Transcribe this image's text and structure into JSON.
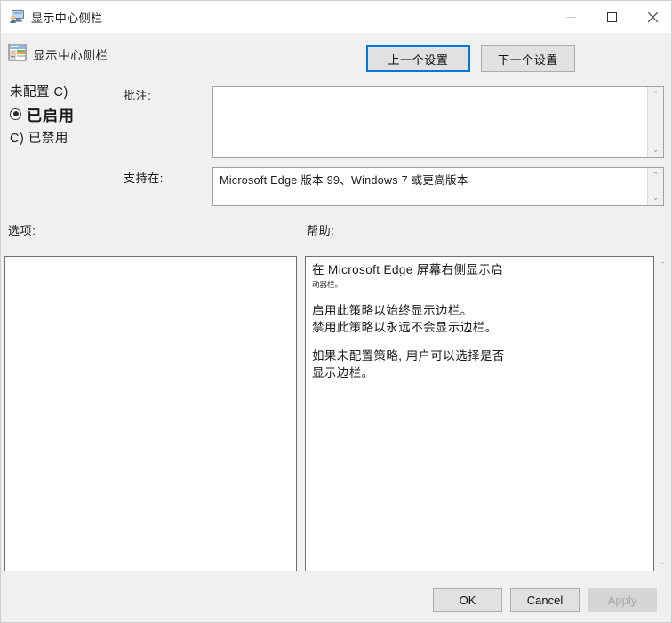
{
  "window": {
    "title": "显示中心侧栏",
    "title_icon": "computer-user-icon",
    "controls": {
      "minimize": "minimize-icon",
      "maximize": "maximize-icon",
      "close": "close-icon"
    }
  },
  "header": {
    "icon": "policy-setting-icon",
    "title": "显示中心侧栏",
    "prev_button": "上一个设置",
    "next_button": "下一个设置"
  },
  "radio_options": [
    {
      "label": "未配置 C)",
      "checked": false,
      "fallback_glyph": ""
    },
    {
      "label": "已启用",
      "checked": true,
      "fallback_glyph": ""
    },
    {
      "label": "C) 已禁用",
      "checked": false,
      "fallback_glyph": ""
    }
  ],
  "fields": {
    "comment_label": "批注:",
    "comment_value": "",
    "supported_label": "支持在:",
    "supported_value": "Microsoft Edge 版本 99、Windows 7 或更高版本",
    "options_label": "选项:",
    "help_label": "帮助:"
  },
  "options_panel": {
    "items": []
  },
  "help_text": {
    "line1": "在 Microsoft Edge 屏幕右侧显示启",
    "line2": "动器栏。",
    "para2_line1": "启用此策略以始终显示边栏。",
    "para2_line2": "禁用此策略以永远不会显示边栏。",
    "para3_line1": "如果未配置策略, 用户可以选择是否",
    "para3_line2": "显示边栏。"
  },
  "footer": {
    "ok": "OK",
    "cancel": "Cancel",
    "apply": "Apply",
    "apply_enabled": false
  },
  "colors": {
    "window_bg": "#f0f0f0",
    "titlebar_bg": "#ffffff",
    "field_bg": "#ffffff",
    "focus_border": "#0078d7",
    "button_face": "#e1e1e1",
    "button_border": "#adadad",
    "disabled_text": "#a6a6a6"
  },
  "scrollbars": {
    "up_arrow": "⌃",
    "down_arrow": "⌄"
  }
}
